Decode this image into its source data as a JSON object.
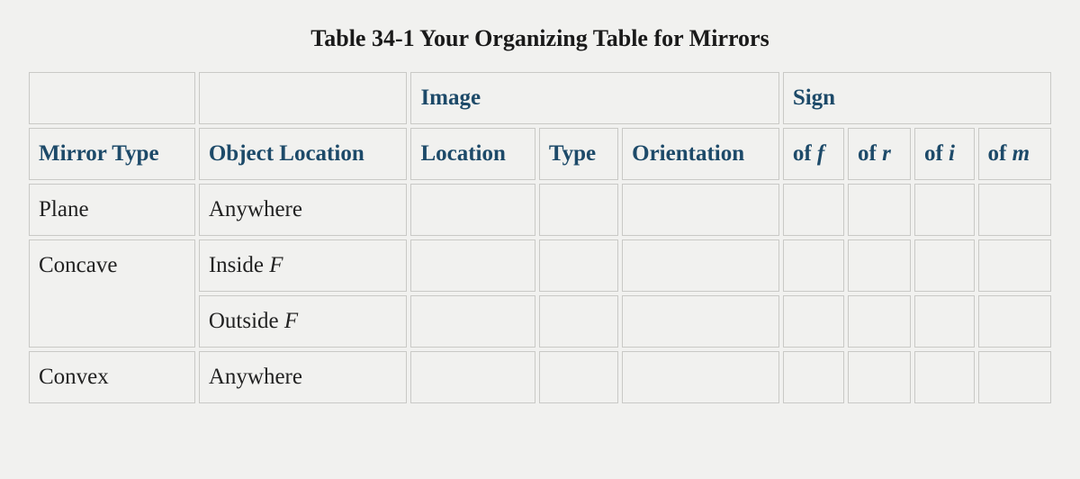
{
  "title": "Table 34-1 Your Organizing Table for Mirrors",
  "header_groups": {
    "image": "Image",
    "sign": "Sign"
  },
  "columns": {
    "mirror_type": "Mirror Type",
    "object_location": "Object Location",
    "location": "Location",
    "type": "Type",
    "orientation": "Orientation",
    "of_f_pre": "of ",
    "of_f_var": "f",
    "of_r_pre": "of ",
    "of_r_var": "r",
    "of_i_pre": "of ",
    "of_i_var": "i",
    "of_m_pre": "of ",
    "of_m_var": "m"
  },
  "rows": [
    {
      "mirror_type": "Plane",
      "object_location": "Anywhere",
      "location": "",
      "type": "",
      "orientation": "",
      "of_f": "",
      "of_r": "",
      "of_i": "",
      "of_m": ""
    },
    {
      "mirror_type": "Concave",
      "mirror_type_rowspan": 2,
      "object_location_pre": "Inside ",
      "object_location_var": "F",
      "location": "",
      "type": "",
      "orientation": "",
      "of_f": "",
      "of_r": "",
      "of_i": "",
      "of_m": ""
    },
    {
      "object_location_pre": "Outside ",
      "object_location_var": "F",
      "location": "",
      "type": "",
      "orientation": "",
      "of_f": "",
      "of_r": "",
      "of_i": "",
      "of_m": ""
    },
    {
      "mirror_type": "Convex",
      "object_location": "Anywhere",
      "location": "",
      "type": "",
      "orientation": "",
      "of_f": "",
      "of_r": "",
      "of_i": "",
      "of_m": ""
    }
  ]
}
